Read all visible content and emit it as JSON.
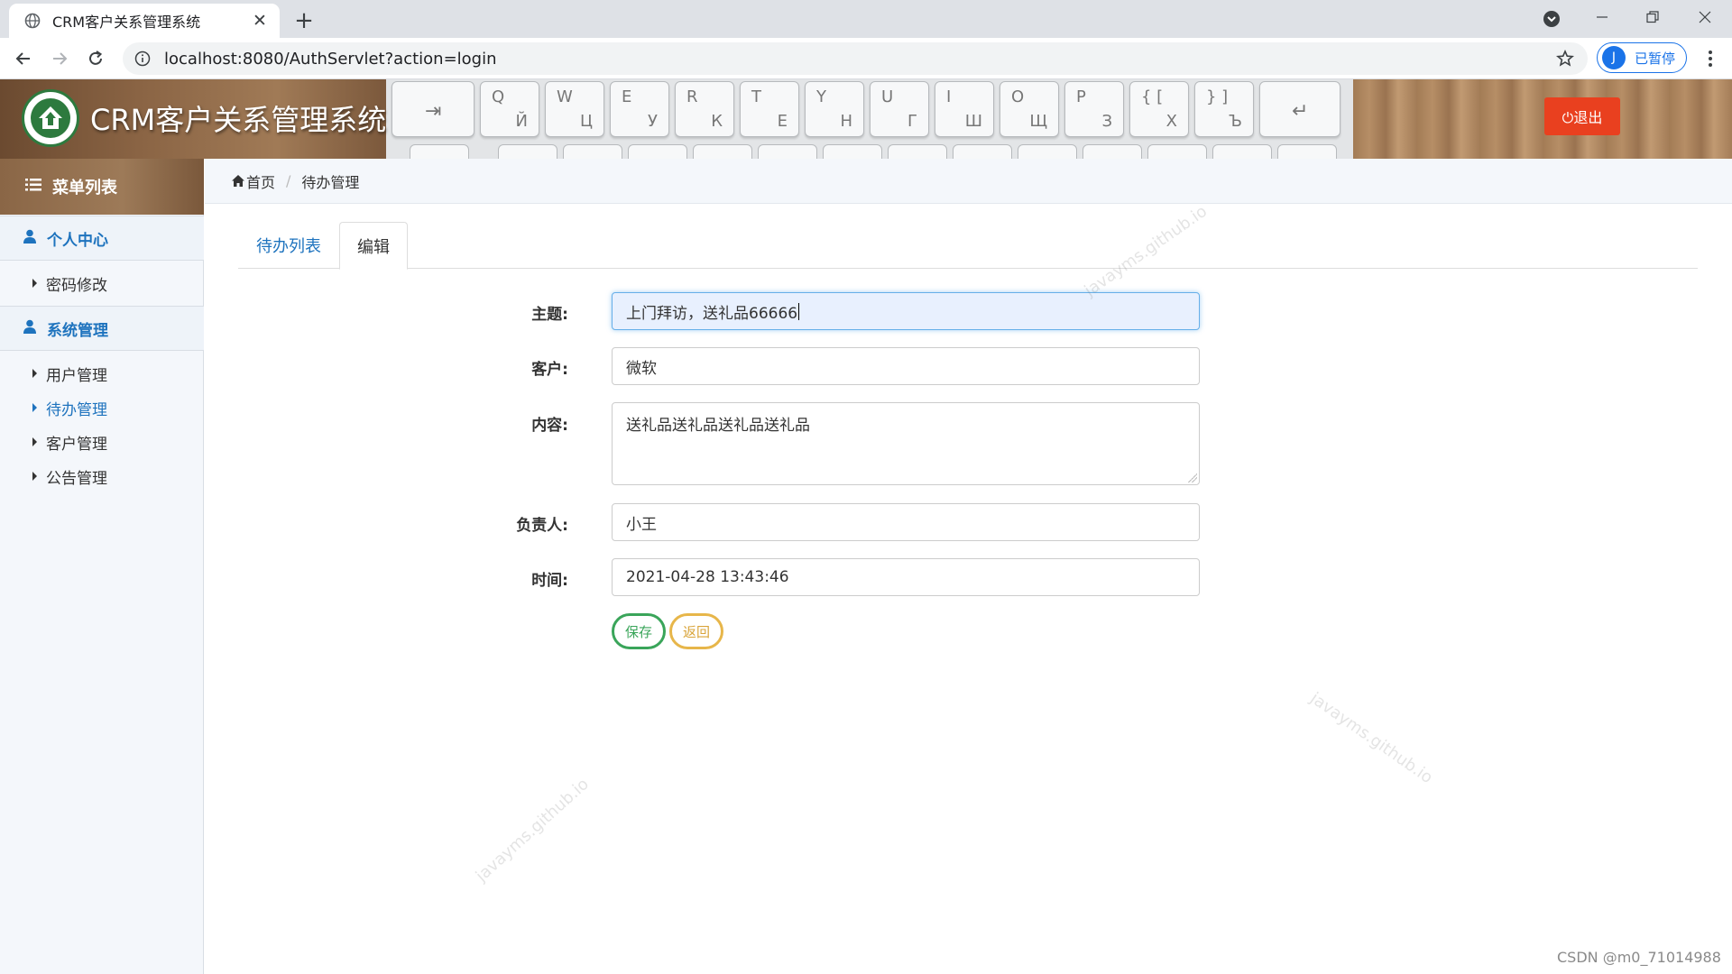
{
  "browser": {
    "tab_title": "CRM客户关系管理系统",
    "url": "localhost:8080/AuthServlet?action=login",
    "profile_initial": "J",
    "profile_label": "已暂停"
  },
  "header": {
    "app_title": "CRM客户关系管理系统",
    "logout_label": "⏻退出",
    "keyboard_glyphs": [
      "⇥",
      "Q",
      "Й",
      "W",
      "Ц",
      "E",
      "У",
      "R",
      "К",
      "T",
      "Е",
      "Y",
      "Н",
      "U",
      "Г",
      "I",
      "Ш",
      "O",
      "Щ",
      "P",
      "З",
      "{ [",
      "Х",
      "} ]",
      "Ъ",
      "↵"
    ]
  },
  "sidebar": {
    "menu_title": "菜单列表",
    "groups": [
      {
        "label": "个人中心",
        "items": [
          {
            "label": "密码修改"
          }
        ]
      },
      {
        "label": "系统管理",
        "items": [
          {
            "label": "用户管理"
          },
          {
            "label": "待办管理"
          },
          {
            "label": "客户管理"
          },
          {
            "label": "公告管理"
          }
        ]
      }
    ],
    "active_item": "待办管理"
  },
  "breadcrumb": {
    "home": "首页",
    "current": "待办管理"
  },
  "tabs": [
    {
      "label": "待办列表"
    },
    {
      "label": "编辑"
    }
  ],
  "form": {
    "subject_label": "主题:",
    "subject_value": "上门拜访，送礼品66666",
    "customer_label": "客户:",
    "customer_value": "微软",
    "content_label": "内容:",
    "content_value": "送礼品送礼品送礼品送礼品",
    "owner_label": "负责人:",
    "owner_value": "小王",
    "time_label": "时间:",
    "time_value": "2021-04-28 13:43:46",
    "save_label": "保存",
    "back_label": "返回"
  },
  "watermark_text": "javayms.github.io",
  "footer_credit": "CSDN @m0_71014988",
  "colors": {
    "accent": "#1e73be",
    "logout": "#e9401f",
    "save": "#3aa55a",
    "back": "#e7b64a"
  }
}
